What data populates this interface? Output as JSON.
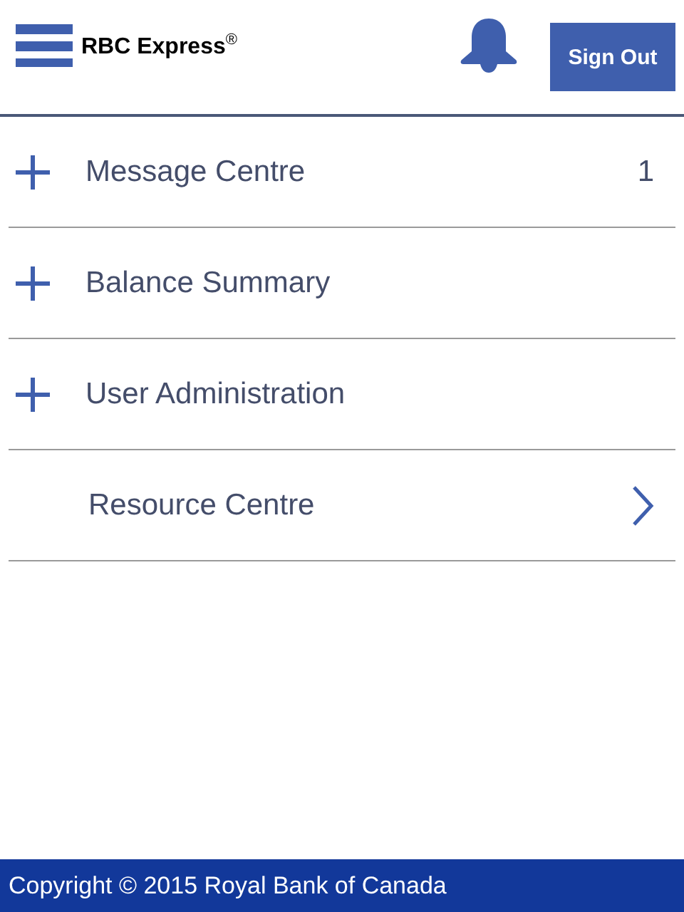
{
  "header": {
    "title": "RBC Express$^{®}$",
    "sign_out": "Sign Out"
  },
  "menu": [
    {
      "kind": "expandable",
      "label": "Message Centre",
      "count": "1"
    },
    {
      "kind": "expandable",
      "label": "Balance Summary"
    },
    {
      "kind": "expandable",
      "label": "User Administration"
    },
    {
      "kind": "link",
      "label": "Resource Centre"
    }
  ],
  "footer": "Copyright © 2015 Royal Bank of Canada"
}
